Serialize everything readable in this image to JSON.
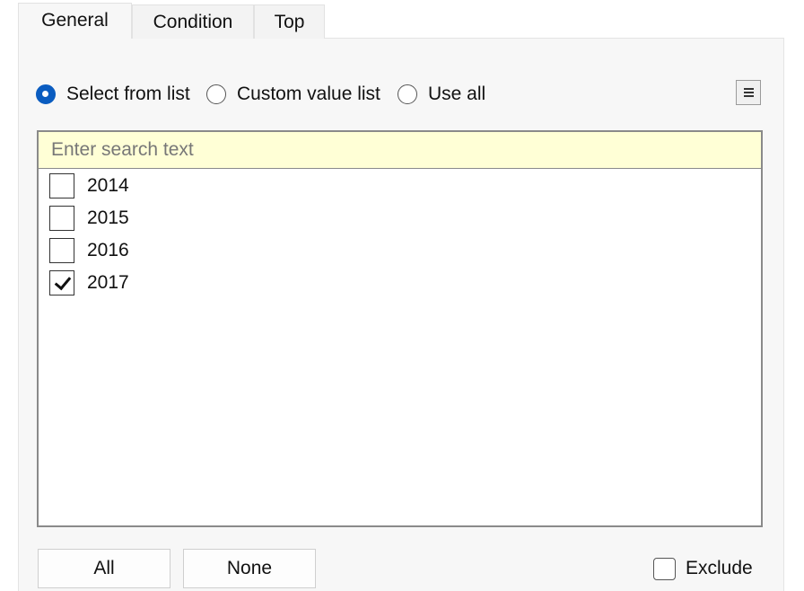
{
  "tabs": [
    {
      "label": "General",
      "active": true
    },
    {
      "label": "Condition",
      "active": false
    },
    {
      "label": "Top",
      "active": false
    }
  ],
  "source_mode": {
    "options": [
      {
        "label": "Select from list",
        "selected": true
      },
      {
        "label": "Custom value list",
        "selected": false
      },
      {
        "label": "Use all",
        "selected": false
      }
    ],
    "menu_icon": "hamburger-menu-icon"
  },
  "search": {
    "placeholder": "Enter search text",
    "value": ""
  },
  "values": [
    {
      "label": "2014",
      "checked": false
    },
    {
      "label": "2015",
      "checked": false
    },
    {
      "label": "2016",
      "checked": false
    },
    {
      "label": "2017",
      "checked": true
    }
  ],
  "buttons": {
    "all_label": "All",
    "none_label": "None"
  },
  "exclude": {
    "label": "Exclude",
    "checked": false
  },
  "colors": {
    "accent": "#0a5cc0",
    "search_background": "#ffffd6"
  }
}
